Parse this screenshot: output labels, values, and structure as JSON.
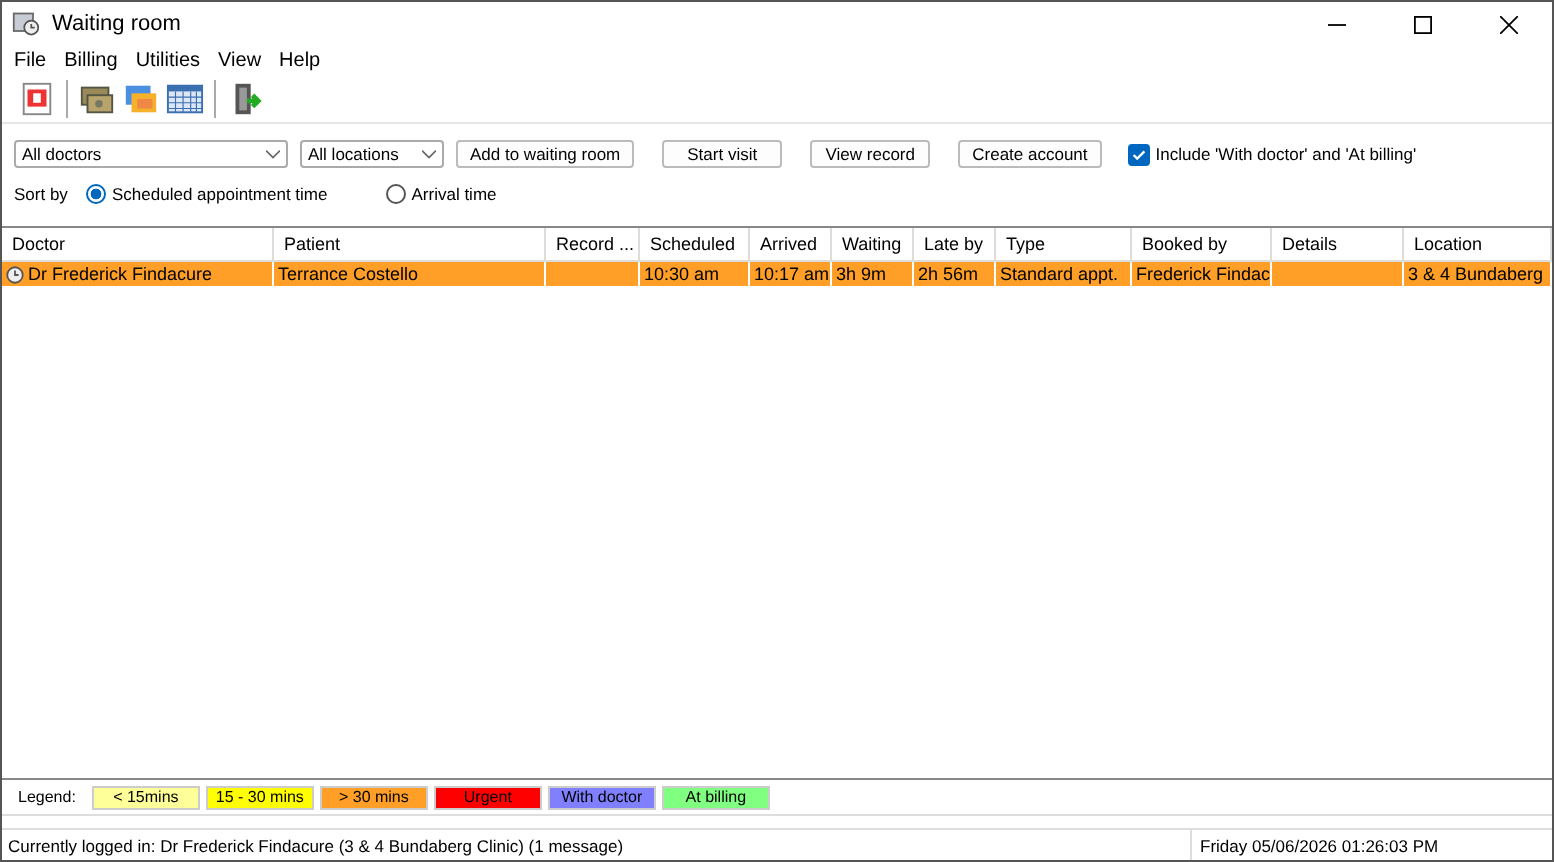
{
  "window": {
    "title": "Waiting room"
  },
  "menu": [
    "File",
    "Billing",
    "Utilities",
    "View",
    "Help"
  ],
  "filters": {
    "doctor": "All doctors",
    "location": "All locations"
  },
  "buttons": [
    "Add to waiting room",
    "Start visit",
    "View record",
    "Create account"
  ],
  "include_option": {
    "label": "Include 'With doctor' and 'At billing'",
    "checked": true
  },
  "sort": {
    "label": "Sort by",
    "options": [
      {
        "label": "Scheduled appointment time",
        "selected": true
      },
      {
        "label": "Arrival time",
        "selected": false
      }
    ]
  },
  "table": {
    "columns": [
      "Doctor",
      "Patient",
      "Record ...",
      "Scheduled",
      "Arrived",
      "Waiting",
      "Late by",
      "Type",
      "Booked by",
      "Details",
      "Location"
    ],
    "rows": [
      {
        "color": "#ff9f27",
        "cells": [
          "Dr Frederick Findacure",
          "Terrance Costello",
          "",
          "10:30 am",
          "10:17 am",
          "3h 9m",
          "2h 56m",
          "Standard appt.",
          "Frederick Findac",
          "",
          "3 & 4 Bundaberg"
        ]
      }
    ]
  },
  "legend": {
    "label": "Legend:",
    "items": [
      {
        "label": "< 15mins",
        "color": "#ffff99"
      },
      {
        "label": "15 - 30 mins",
        "color": "#ffff00"
      },
      {
        "label": "> 30 mins",
        "color": "#ff9f27"
      },
      {
        "label": "Urgent",
        "color": "#ff0000"
      },
      {
        "label": "With doctor",
        "color": "#8080ff"
      },
      {
        "label": "At billing",
        "color": "#80ff80"
      }
    ]
  },
  "status_bar": {
    "login": "Currently logged in:  Dr Frederick Findacure (3 & 4 Bundaberg Clinic) (1 message)",
    "datetime": "Friday 05/06/2026 01:26:03 PM"
  }
}
